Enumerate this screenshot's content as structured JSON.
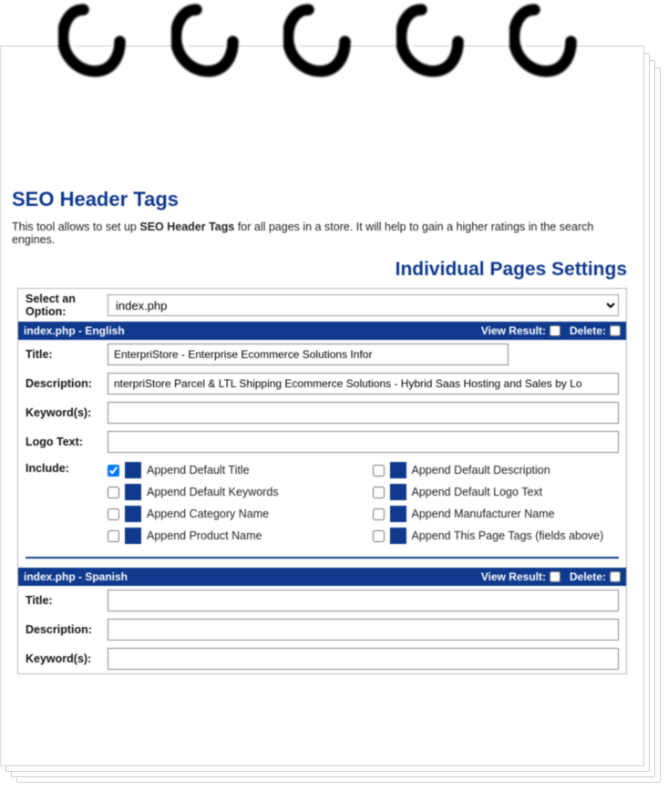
{
  "heading": "SEO Header Tags",
  "subtext_pre": "This tool allows to set up ",
  "subtext_bold": "SEO Header Tags",
  "subtext_post": " for all pages in a store. It will help to gain a higher ratings in the search engines.",
  "section_title": "Individual Pages Settings",
  "select_label": "Select an Option:",
  "select_value": "index.php",
  "view_result": "View Result:",
  "delete": "Delete:",
  "labels": {
    "title": "Title:",
    "description": "Description:",
    "keywords": "Keyword(s):",
    "logo_text": "Logo Text:",
    "include": "Include:"
  },
  "english": {
    "bar": "index.php - English",
    "title": "EnterpriStore - Enterprise Ecommerce Solutions Infor",
    "description": "nterpriStore Parcel & LTL Shipping Ecommerce Solutions - Hybrid Saas Hosting and Sales by Lo",
    "keywords": "",
    "logo_text": ""
  },
  "spanish": {
    "bar": "index.php - Spanish",
    "title": "",
    "description": "",
    "keywords": ""
  },
  "include_options": [
    {
      "label": "Append Default Title",
      "checked": true
    },
    {
      "label": "Append Default Description",
      "checked": false
    },
    {
      "label": "Append Default Keywords",
      "checked": false
    },
    {
      "label": "Append Default Logo Text",
      "checked": false
    },
    {
      "label": "Append Category Name",
      "checked": false
    },
    {
      "label": "Append Manufacturer Name",
      "checked": false
    },
    {
      "label": "Append Product Name",
      "checked": false
    },
    {
      "label": "Append This Page Tags (fields above)",
      "checked": false
    }
  ]
}
